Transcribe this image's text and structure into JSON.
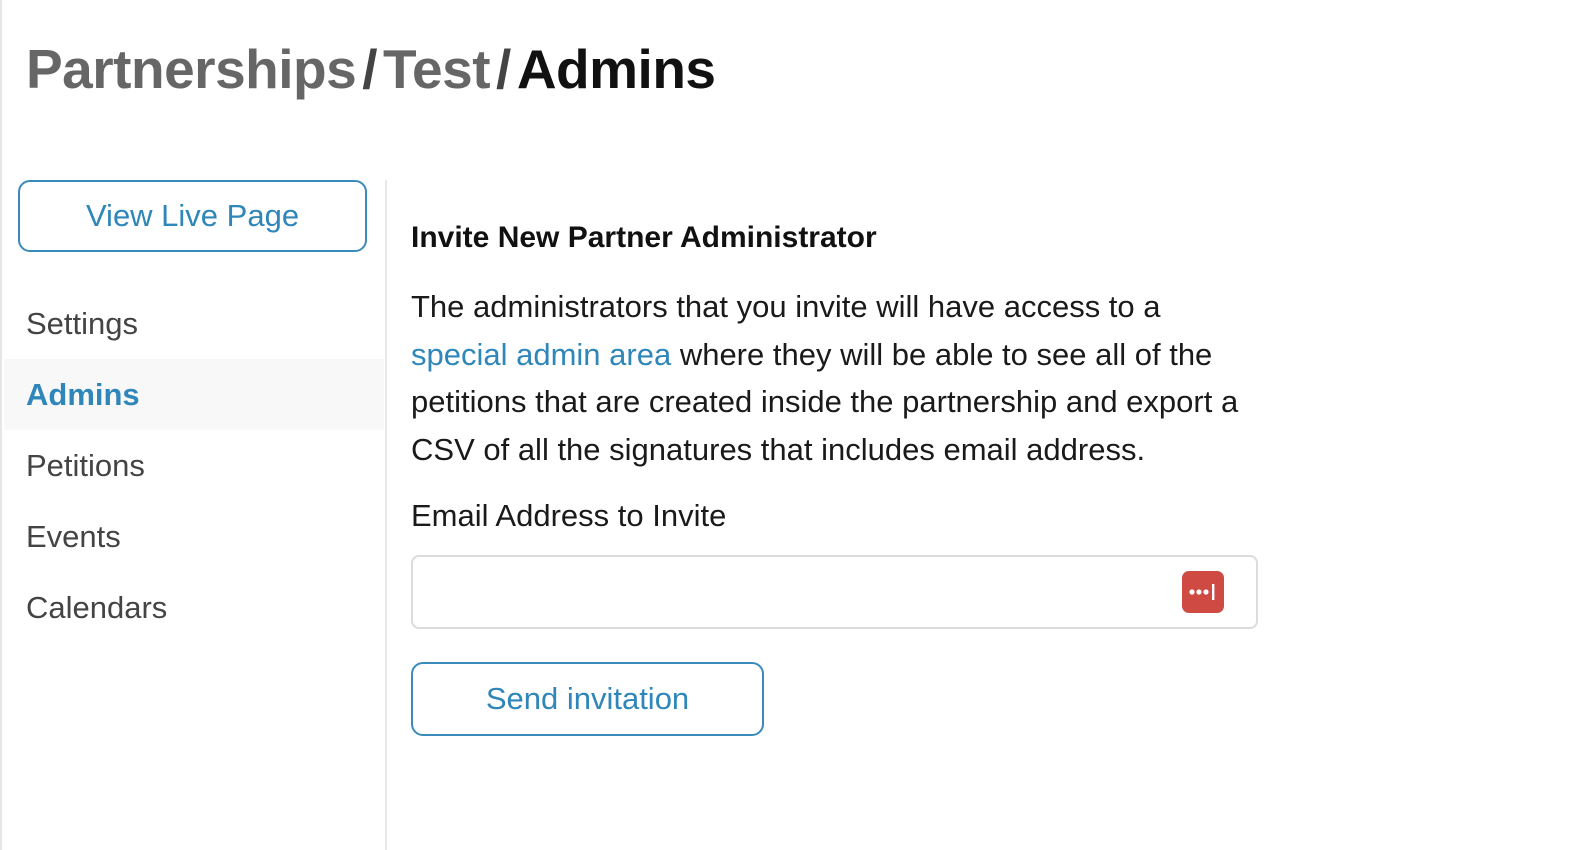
{
  "breadcrumb": {
    "items": [
      "Partnerships",
      "Test"
    ],
    "separator": "/",
    "current": "Admins"
  },
  "sidebar": {
    "view_live_label": "View Live Page",
    "items": [
      {
        "label": "Settings",
        "active": false
      },
      {
        "label": "Admins",
        "active": true
      },
      {
        "label": "Petitions",
        "active": false
      },
      {
        "label": "Events",
        "active": false
      },
      {
        "label": "Calendars",
        "active": false
      }
    ]
  },
  "main": {
    "title": "Invite New Partner Administrator",
    "description_before": "The administrators that you invite will have access to a ",
    "description_link": "special admin area",
    "description_after": " where they will be able to see all of the petitions that are created inside the partnership and export a CSV of all the signatures that includes email address.",
    "email_label": "Email Address to Invite",
    "email_value": "",
    "send_label": "Send invitation"
  },
  "icons": {
    "password_manager": "password-manager-icon"
  },
  "colors": {
    "accent": "#2f86b9",
    "icon_red": "#cf4a42"
  }
}
